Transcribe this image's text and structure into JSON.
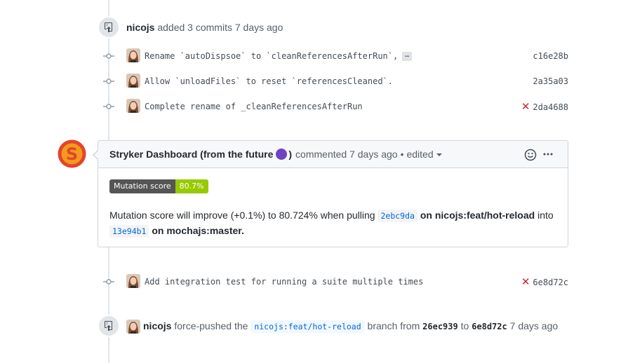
{
  "event1": {
    "user": "nicojs",
    "action": "added 3 commits 7 days ago"
  },
  "commits_top": [
    {
      "message": "Rename `autoDispsoe` to `cleanReferencesAfterRun`,",
      "has_ellipsis": true,
      "ellipsis": "…",
      "sha": "c16e28b",
      "failed": false
    },
    {
      "message": "Allow `unloadFiles` to reset `referencesCleaned`.",
      "has_ellipsis": false,
      "sha": "2a35a03",
      "failed": false
    },
    {
      "message": "Complete rename of _cleanReferencesAfterRun",
      "has_ellipsis": false,
      "sha": "2da4688",
      "failed": true
    }
  ],
  "comment": {
    "author": "Stryker Dashboard (from the future",
    "author_close": ")",
    "meta": "commented 7 days ago",
    "sep": "•",
    "edited": "edited",
    "badge_label": "Mutation score",
    "badge_value": "80.7%",
    "text1": "Mutation score will improve (+0.1%) to 80.724% when pulling",
    "sha_from": "2ebc9da",
    "text2": "on nicojs:feat/hot-reload",
    "text3": "into",
    "sha_to": "13e94b1",
    "text4": "on mochajs:master."
  },
  "commit_mid": {
    "message": "Add integration test for running a suite multiple times",
    "sha": "6e8d72c",
    "failed": true
  },
  "event2": {
    "user": "nicojs",
    "action": "force-pushed the",
    "branch": "nicojs:feat/hot-reload",
    "text_branch_from": "branch from",
    "from_sha": "26ec939",
    "to": "to",
    "to_sha": "6e8d72c",
    "time": "7 days ago"
  },
  "colors": {
    "fail": "#cb2431",
    "link": "#0366d6",
    "badge_ok": "#97ca00"
  }
}
